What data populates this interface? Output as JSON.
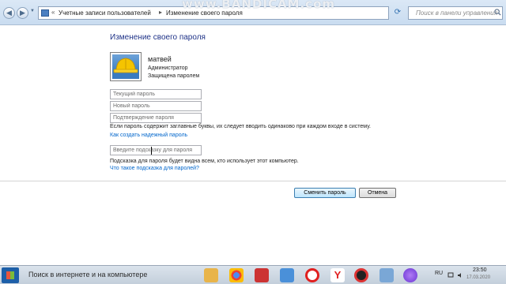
{
  "addressbar": {
    "breadcrumb_sep": "«",
    "crumb1": "Учетные записи пользователей",
    "crumb_arrow": "▸",
    "crumb2": "Изменение своего пароля",
    "search_placeholder": "Поиск в панели управления"
  },
  "watermark": "www.BANDICAM.com",
  "page": {
    "title": "Изменение своего пароля",
    "user": {
      "name": "матвей",
      "role": "Администратор",
      "status": "Защищена паролем"
    },
    "fields": {
      "current_placeholder": "Текущий пароль",
      "new_placeholder": "Новый пароль",
      "confirm_placeholder": "Подтверждение пароля",
      "hint_placeholder": "Введите подсказку для пароля"
    },
    "case_note": "Если пароль содержит заглавные буквы, их следует вводить одинаково при каждом входе в систему.",
    "strong_password_link": "Как создать надежный пароль",
    "hint_note": "Подсказка для пароля будет видна всем, кто использует этот компьютер.",
    "hint_link": "Что такое подсказка для паролей?",
    "buttons": {
      "change": "Сменить пароль",
      "cancel": "Отмена"
    }
  },
  "taskbar": {
    "search_text": "Поиск в интернете и на компьютере",
    "language": "RU",
    "time": "23:50",
    "date": "17.03.2020"
  },
  "colors": {
    "title_blue": "#1e3287",
    "link_blue": "#0066cc",
    "primary_button": "#bee6fd"
  }
}
